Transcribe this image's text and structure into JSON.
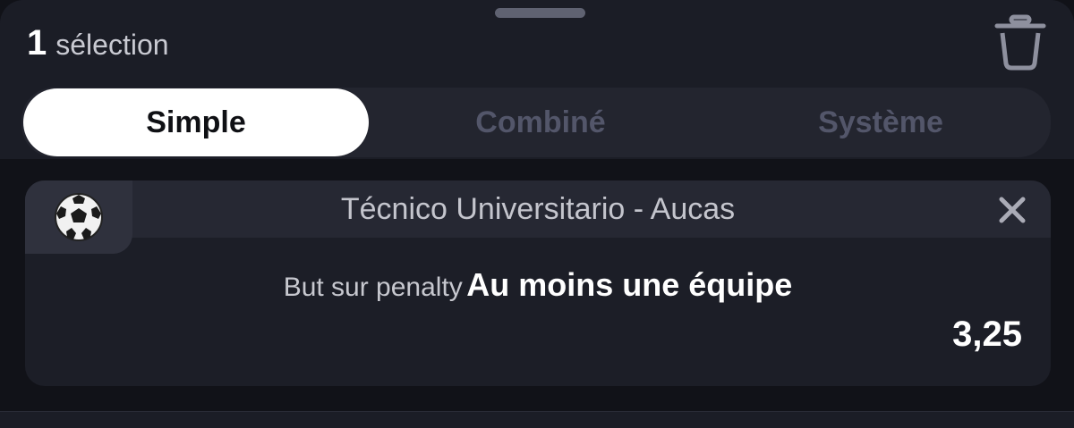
{
  "header": {
    "count": "1",
    "count_label": "sélection",
    "trash_icon": "trash-icon"
  },
  "tabs": [
    {
      "label": "Simple",
      "active": true
    },
    {
      "label": "Combiné",
      "active": false
    },
    {
      "label": "Système",
      "active": false
    }
  ],
  "bet": {
    "sport_icon": "soccer-ball-icon",
    "match": "Técnico Universitario - Aucas",
    "market": "But sur penalty",
    "pick": "Au moins une équipe",
    "odds": "3,25",
    "close_icon": "close-icon"
  },
  "colors": {
    "background": "#111218",
    "panel": "#1b1d26",
    "active_tab": "#ffffff",
    "inactive_tab_text": "#53566a"
  }
}
